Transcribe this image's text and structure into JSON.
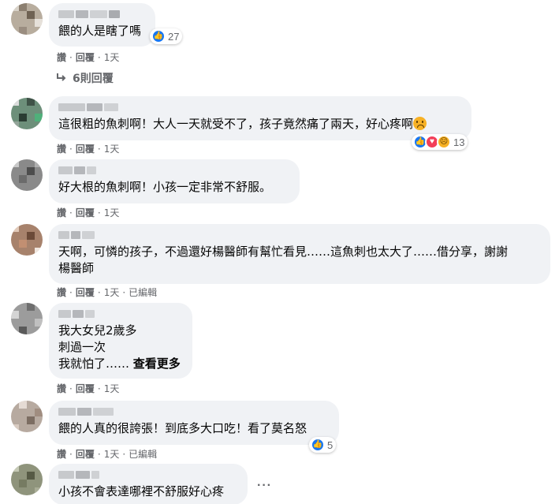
{
  "comments": [
    {
      "text": "餵的人是瞎了嗎",
      "actions": {
        "like": "讚",
        "reply": "回覆",
        "time": "1天"
      },
      "reactions": {
        "count": "27",
        "types": [
          "like-icon"
        ]
      }
    },
    {
      "text": "這很粗的魚刺啊！大人一天就受不了，孩子竟然痛了兩天，好心疼啊",
      "actions": {
        "like": "讚",
        "reply": "回覆",
        "time": "1天"
      },
      "reactions": {
        "count": "13",
        "types": [
          "like-icon",
          "love-icon",
          "sad-icon"
        ]
      }
    },
    {
      "text": "好大根的魚刺啊！小孩一定非常不舒服。",
      "actions": {
        "like": "讚",
        "reply": "回覆",
        "time": "1天"
      }
    },
    {
      "text": "天啊，可憐的孩子，不過還好楊醫師有幫忙看見……這魚刺也太大了……借分享，謝謝\n楊醫師",
      "actions": {
        "like": "讚",
        "reply": "回覆",
        "time": "1天",
        "edited": "已編輯"
      }
    },
    {
      "text": "我大女兒2歲多\n刺過一次\n我就怕了……",
      "see_more": "查看更多",
      "actions": {
        "like": "讚",
        "reply": "回覆",
        "time": "1天"
      }
    },
    {
      "text": "餵的人真的很誇張！到底多大口吃！看了莫名怒",
      "actions": {
        "like": "讚",
        "reply": "回覆",
        "time": "1天",
        "edited": "已編輯"
      },
      "reactions": {
        "count": "5",
        "types": [
          "like-icon"
        ]
      }
    },
    {
      "text": "小孩不會表達哪裡不舒服好心疼"
    }
  ],
  "replies_link": "6則回覆",
  "separator": "·",
  "more_options": "···"
}
